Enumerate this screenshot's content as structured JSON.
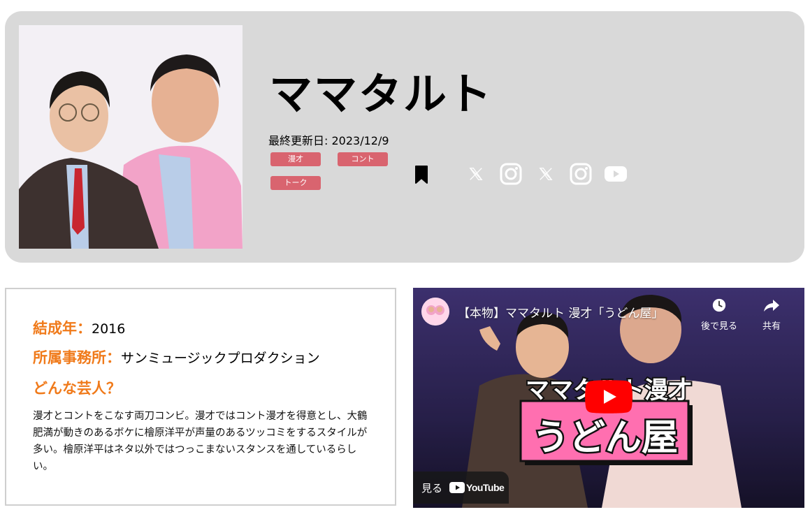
{
  "profile": {
    "name": "ママタルト",
    "updated": "最終更新日: 2023/12/9",
    "tags": [
      "漫才",
      "コント",
      "トーク"
    ],
    "bookmark_icon": "bookmark-icon",
    "social_icons": [
      "x-icon",
      "instagram-icon",
      "x-icon",
      "instagram-icon",
      "youtube-icon"
    ]
  },
  "info": {
    "formed_label": "結成年：",
    "formed_value": "2016",
    "agency_label": "所属事務所：",
    "agency_value": "サンミュージックプロダクション",
    "about_label": "どんな芸人？",
    "description": "漫才とコントをこなす両刀コンビ。漫才ではコント漫才を得意とし、大鶴肥満が動きのあるボケに檜原洋平が声量のあるツッコミをするスタイルが多い。檜原洋平はネタ以外ではつっこまないスタンスを通しているらしい。"
  },
  "video": {
    "title": "【本物】ママタルト 漫才「うどん屋」",
    "watch_later": "後で見る",
    "share": "共有",
    "watch_on": "見る",
    "youtube_brand": "YouTube",
    "thumb_text_top": "ママタルト漫才",
    "thumb_text_main": "うどん屋"
  },
  "colors": {
    "card_bg": "#d9d9d9",
    "tag_bg": "#d9646f",
    "label_orange": "#f07a1a",
    "youtube_red": "#ff0000",
    "thumb_pink": "#ff6fb0"
  }
}
